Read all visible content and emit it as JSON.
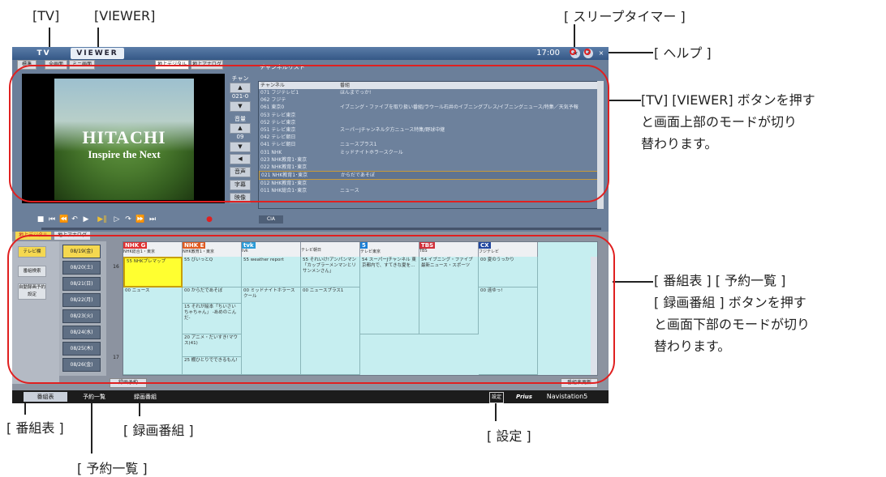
{
  "annotations": {
    "tv_tab": "[TV]",
    "viewer_tab": "[VIEWER]",
    "sleep_timer": "[ スリープタイマー ]",
    "help": "[ ヘルプ ]",
    "upper_desc_lines": [
      "[TV] [VIEWER] ボタンを押す",
      "と画面上部のモードが切り",
      "替わります。"
    ],
    "lower_title_lines": [
      "[ 番組表 ] [ 予約一覧 ]",
      "[ 録画番組 ] ボタンを押す",
      "と画面下部のモードが切り",
      "替わります。"
    ],
    "bangumi": "[ 番組表 ]",
    "rokuga": "[ 録画番組 ]",
    "settings": "[ 設定 ]",
    "yoyaku": "[ 予約一覧 ]"
  },
  "app": {
    "tab_tv": "TV",
    "tab_viewer": "VIEWER",
    "clock": "17:00",
    "btn_sleep": "★",
    "btn_help": "?",
    "btn_close": "×",
    "view_buttons": [
      "標準",
      "全画面",
      "ミニ画面"
    ],
    "source_tabs": [
      "地上デジタル",
      "地上アナログ"
    ],
    "channel_label": "チャンネル",
    "channel_value": "021-0",
    "volume_label": "音量",
    "volume_value": "09",
    "side_buttons": [
      "音声",
      "字幕",
      "映像"
    ],
    "video_logo": "HITACHI",
    "video_tagline": "Inspire the Next",
    "channel_list_title": "チャンネルリスト",
    "channel_list_headers": [
      "チャンネル",
      "番組"
    ],
    "channel_rows": [
      {
        "ch": "071 フジテレビ1",
        "prog": "ほんまでっか!"
      },
      {
        "ch": "062 フジテ",
        "prog": ""
      },
      {
        "ch": "061 東京0",
        "prog": "イブニング・ファイブを取り扱い番組/ラウール石井のイブニングプレス/イブニングニュース/特集／天気予報"
      },
      {
        "ch": "053 テレビ東京",
        "prog": ""
      },
      {
        "ch": "052 テレビ東京",
        "prog": ""
      },
      {
        "ch": "051 テレビ東京",
        "prog": "スーパーJチャンネル夕方ニュース特集/野球中継"
      },
      {
        "ch": "042 テレビ朝日",
        "prog": ""
      },
      {
        "ch": "041 テレビ朝日",
        "prog": "ニュースプラス1"
      },
      {
        "ch": "031 NHK",
        "prog": "ミッドナイトホラースクール"
      },
      {
        "ch": "023 NHK教育1･東京",
        "prog": ""
      },
      {
        "ch": "022 NHK教育1･東京",
        "prog": ""
      },
      {
        "ch": "021 NHK教育1･東京",
        "prog": "からだであそぼ"
      },
      {
        "ch": "012 NHK教育1･東京",
        "prog": ""
      },
      {
        "ch": "011 NHK総合1･東京",
        "prog": "ニュース"
      }
    ],
    "cia_label": "CIA",
    "lower_tabs": [
      "地上デジタル",
      "地上アナログ"
    ],
    "left_buttons": [
      "テレビ欄",
      "番組検索",
      "自動録画予約設定"
    ],
    "dates": [
      "08/19(金)",
      "08/20(土)",
      "08/21(日)",
      "08/22(月)",
      "08/23(火)",
      "08/24(水)",
      "08/25(木)",
      "08/26(金)"
    ],
    "hours": [
      "16",
      "17"
    ],
    "channel_heads": [
      {
        "logo": "NHK G",
        "name": "NHK総合1・東京",
        "color": "#e03030"
      },
      {
        "logo": "NHK E",
        "name": "NHK教育1・東京",
        "color": "#e05a20"
      },
      {
        "logo": "tvk",
        "name": "tvk",
        "color": "#2b9bd8"
      },
      {
        "logo": "",
        "name": "テレビ朝日",
        "color": "#888888"
      },
      {
        "logo": "5",
        "name": "テレビ東京",
        "color": "#1b7fd6"
      },
      {
        "logo": "TBS",
        "name": "TBS",
        "color": "#d0303a"
      },
      {
        "logo": "CX",
        "name": "フジテレビ",
        "color": "#2046a0"
      }
    ],
    "programs": {
      "p1": "55 NHKプレマップ",
      "p2": "55 びいっとQ",
      "p3": "55 weather report",
      "p4": "55 それいけ!アンパンマン「カップラーメンマンとリサンメンさん」",
      "p5": "54 スーパーJチャンネル 東京都内で、すてきな夏を…",
      "p6": "54 イブニング・ファイブ 最新ニュース・スポーツ",
      "p7": "00 夏のうっかり",
      "p8": "00 ニュース",
      "p9": "00 からだであそぼ",
      "p10": "00 ミッドナイトホラースクール",
      "p11": "00 ニュースプラス1",
      "p12": "00 遠ゆっ!",
      "p13": "15 それが絵本「ちいさいちゃちゃん」 -あめのこんだ-",
      "p14": "20 アニメ・だいすき!マウス(41)",
      "p15": "25 棚ひとりでできるもん!"
    },
    "record_button": "録画予約",
    "refresh_button": "番組表更新",
    "status_tabs": [
      "番組表",
      "予約一覧",
      "録画番組"
    ],
    "settings_button": "設定",
    "brand": "Prius",
    "brand_suffix": "Navistation5"
  },
  "colors": {
    "highlight_oval": "#e02020",
    "program_bg": "#c6eef0",
    "current_program": "#ffff30"
  }
}
